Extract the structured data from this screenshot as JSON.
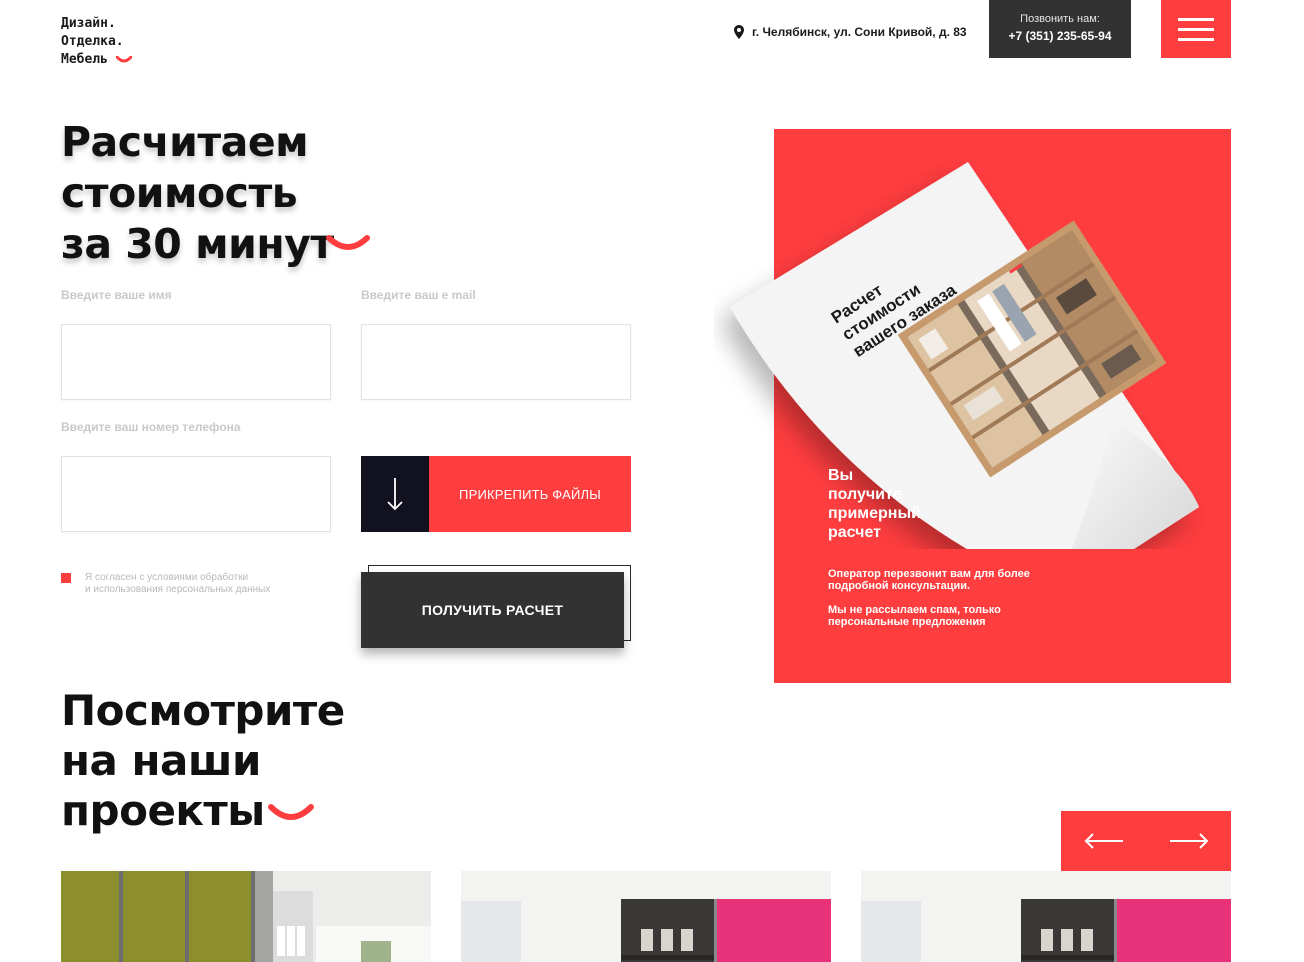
{
  "header": {
    "logo_lines": [
      "Дизайн.",
      "Отделка.",
      "Мебель"
    ],
    "address": "г. Челябинск, ул. Сони Кривой, д. 83",
    "call_label": "Позвонить нам:",
    "phone": "+7 (351) 235-65-94"
  },
  "hero": {
    "title_lines": [
      "Расчитаем",
      "стоимость",
      "за 30 минут"
    ],
    "name_label": "Введите ваше имя",
    "email_label": "Введите ваш е mail",
    "phone_label": "Введите ваш номер телефона",
    "name_value": "",
    "email_value": "",
    "phone_value": "",
    "attach_label": "ПРИКРЕПИТЬ ФАЙЛЫ",
    "consent_lines": [
      "Я согласен с условиями обработки",
      "и использования персональных данных"
    ],
    "submit_label": "ПОЛУЧИТЬ РАСЧЕТ"
  },
  "promo": {
    "sheet_title_lines": [
      "Расчет",
      "стоимости",
      "вашего заказа"
    ],
    "title_lines": [
      "Вы",
      "получите",
      "примерный",
      "расчет"
    ],
    "text1_lines": [
      "Оператор перезвонит вам для более",
      "подробной консультации."
    ],
    "text2_lines": [
      "Мы не рассылаем спам, только",
      "персональные предложения"
    ]
  },
  "projects": {
    "title_lines": [
      "Посмотрите",
      "на наши",
      "проекты"
    ]
  },
  "icons": {
    "address": "location-pin-icon",
    "menu": "hamburger-menu-icon",
    "attach": "arrow-down-icon",
    "prev": "arrow-left-icon",
    "next": "arrow-right-icon"
  },
  "colors": {
    "accent": "#fe3d3f",
    "dark": "#323232",
    "navy": "#12111f"
  }
}
